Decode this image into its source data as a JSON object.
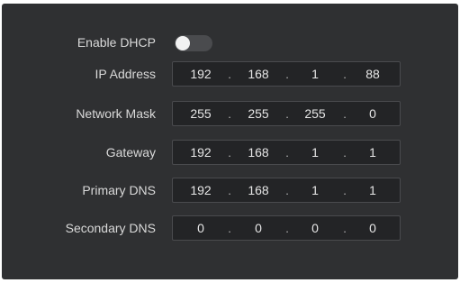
{
  "form": {
    "dhcp": {
      "label": "Enable DHCP",
      "enabled": false
    },
    "fields": [
      {
        "label": "IP Address",
        "octets": [
          "192",
          "168",
          "1",
          "88"
        ]
      },
      {
        "label": "Network Mask",
        "octets": [
          "255",
          "255",
          "255",
          "0"
        ]
      },
      {
        "label": "Gateway",
        "octets": [
          "192",
          "168",
          "1",
          "1"
        ]
      },
      {
        "label": "Primary DNS",
        "octets": [
          "192",
          "168",
          "1",
          "1"
        ]
      },
      {
        "label": "Secondary DNS",
        "octets": [
          "0",
          "0",
          "0",
          "0"
        ]
      }
    ],
    "separator": "."
  }
}
